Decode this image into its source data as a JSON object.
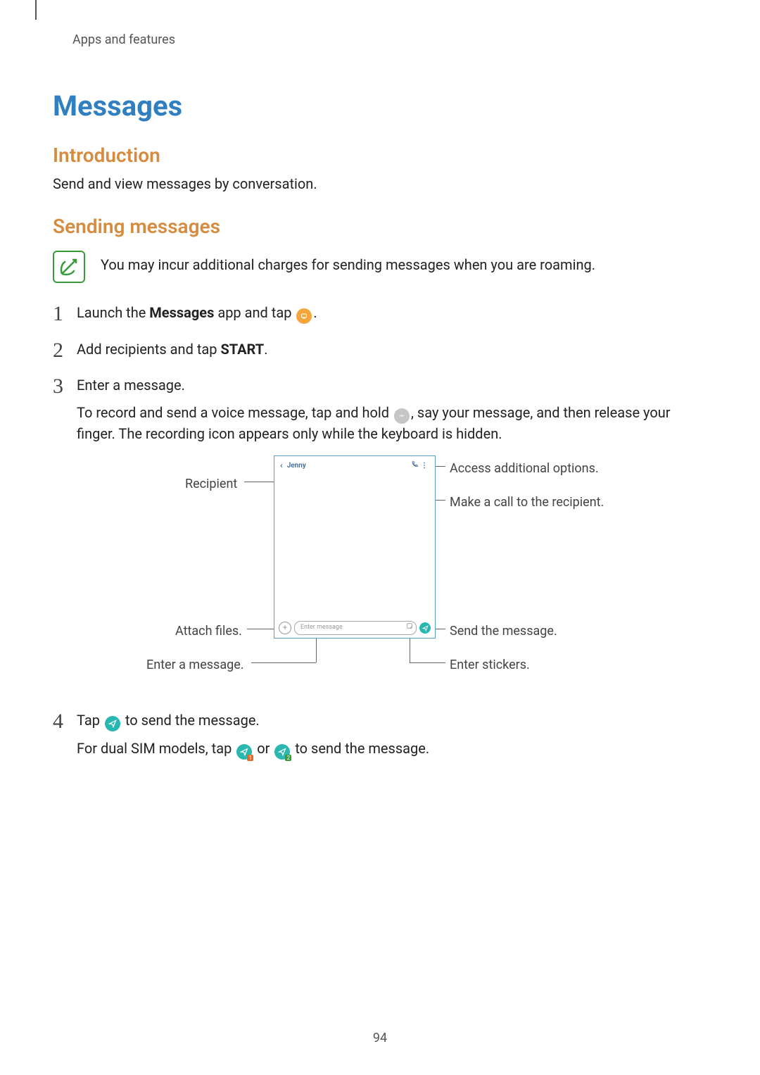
{
  "breadcrumb": "Apps and features",
  "title": "Messages",
  "section_intro_heading": "Introduction",
  "section_intro_text": "Send and view messages by conversation.",
  "section_send_heading": "Sending messages",
  "note_text": "You may incur additional charges for sending messages when you are roaming.",
  "steps": {
    "s1a": "Launch the ",
    "s1_bold": "Messages",
    "s1b": " app and tap ",
    "s1c": ".",
    "s2a": "Add recipients and tap ",
    "s2_bold": "START",
    "s2b": ".",
    "s3a": "Enter a message.",
    "s3b": "To record and send a voice message, tap and hold ",
    "s3c": ", say your message, and then release your finger. The recording icon appears only while the keyboard is hidden.",
    "s4a": "Tap ",
    "s4b": " to send the message.",
    "s4c": "For dual SIM models, tap ",
    "s4_or": " or ",
    "s4d": " to send the message."
  },
  "diagram": {
    "recipient_name": "Jenny",
    "input_placeholder": "Enter message",
    "labels": {
      "recipient": "Recipient",
      "options": "Access additional options.",
      "call": "Make a call to the recipient.",
      "attach": "Attach files.",
      "enter_msg": "Enter a message.",
      "send": "Send the message.",
      "stickers": "Enter stickers."
    }
  },
  "sim": {
    "one": "1",
    "two": "2"
  },
  "page_number": "94"
}
